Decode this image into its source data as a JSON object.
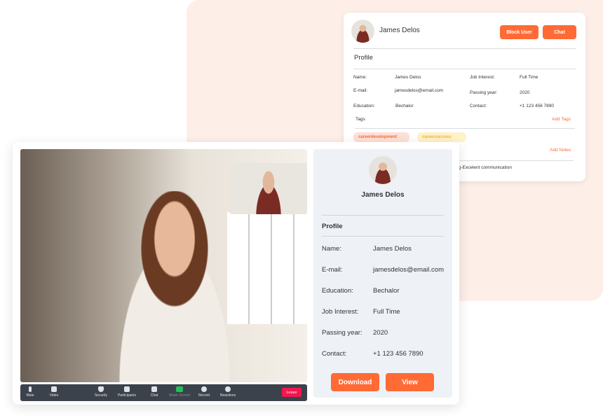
{
  "back_card": {
    "name": "James Delos",
    "block_user": "Block User",
    "chat": "Chat",
    "profile_title": "Profile",
    "fields": [
      {
        "label": "Name:",
        "value": "James Delos"
      },
      {
        "label": "E-mail:",
        "value": "jamesdelos@email.com"
      },
      {
        "label": "Education:",
        "value": "Bechalor"
      },
      {
        "label": "Job Interest:",
        "value": "Full Time"
      },
      {
        "label": "Passing year:",
        "value": "2020"
      },
      {
        "label": "Contact:",
        "value": "+1 123 456 7890"
      }
    ],
    "tags_label": "Tags",
    "add_tags": "Add Tags",
    "tags": [
      "careerdevelopment",
      "careersuccess"
    ],
    "add_notes": "Add Notes",
    "note": "keting-Excelent communication"
  },
  "toolbar": {
    "items": [
      "Mute",
      "Video",
      "Security",
      "Participants",
      "Chat",
      "Share Screen",
      "Record",
      "Reactions"
    ],
    "leave": "Leave",
    "accent": "#f4164f"
  },
  "panel": {
    "name": "James Delos",
    "profile_title": "Profile",
    "fields": [
      {
        "label": "Name:",
        "value": "James Delos"
      },
      {
        "label": "E-mail:",
        "value": "jamesdelos@email.com"
      },
      {
        "label": "Education:",
        "value": "Bechalor"
      },
      {
        "label": "Job Interest:",
        "value": "Full Time"
      },
      {
        "label": "Passing year:",
        "value": "2020"
      },
      {
        "label": "Contact:",
        "value": "+1 123 456 7890"
      }
    ],
    "download": "Download",
    "view": "View"
  },
  "colors": {
    "accent": "#ff6a35",
    "background": "#fdeee8"
  }
}
